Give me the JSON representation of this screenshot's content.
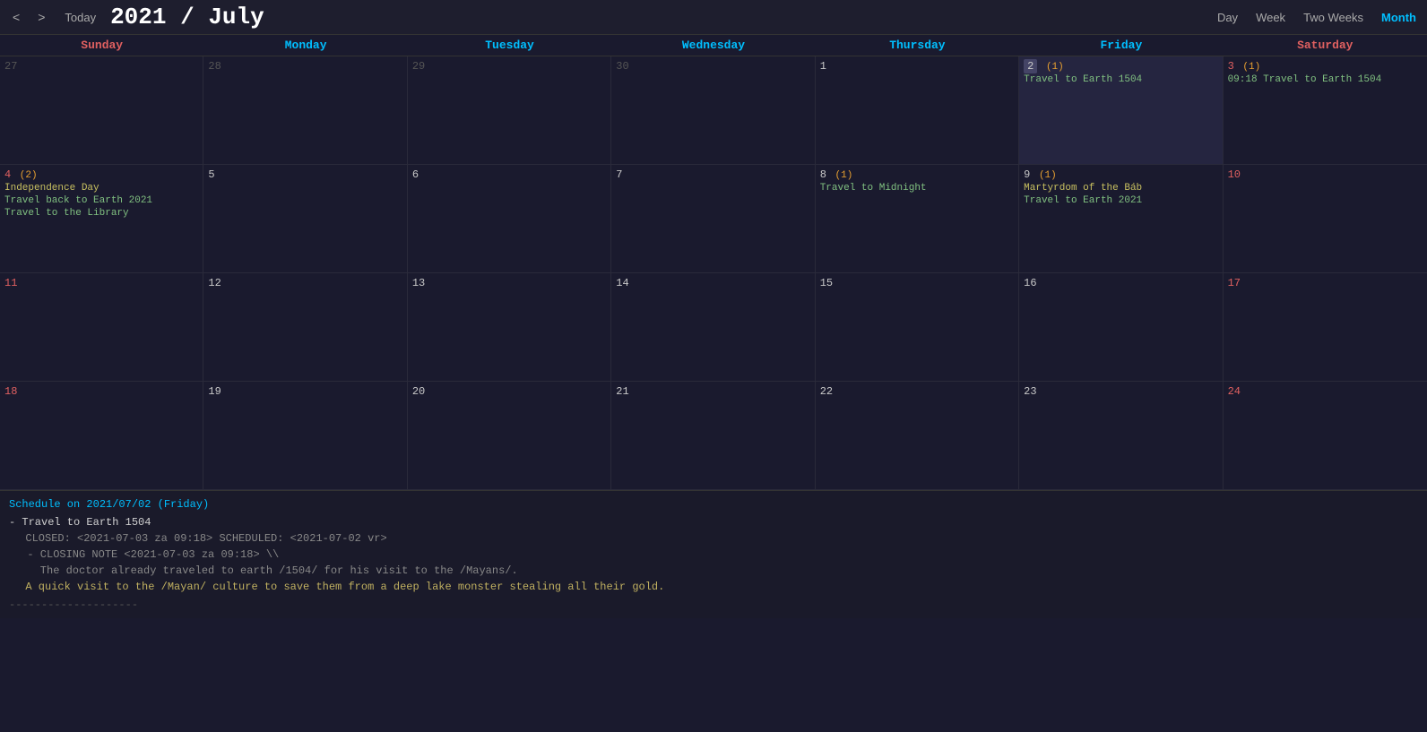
{
  "header": {
    "title_year": "2021",
    "title_separator": " / ",
    "title_month": "July",
    "nav_prev": "<",
    "nav_next": ">",
    "today_label": "Today",
    "views": [
      "Day",
      "Week",
      "Two Weeks",
      "Month"
    ],
    "active_view": "Month"
  },
  "day_headers": [
    {
      "label": "Sunday",
      "type": "sun"
    },
    {
      "label": "Monday",
      "type": "weekday"
    },
    {
      "label": "Tuesday",
      "type": "weekday"
    },
    {
      "label": "Wednesday",
      "type": "weekday"
    },
    {
      "label": "Thursday",
      "type": "weekday"
    },
    {
      "label": "Friday",
      "type": "weekday"
    },
    {
      "label": "Saturday",
      "type": "sat"
    }
  ],
  "weeks": [
    {
      "days": [
        {
          "num": "27",
          "badi": "",
          "other": true,
          "type": "sun",
          "events": []
        },
        {
          "num": "28",
          "badi": "",
          "other": true,
          "type": "weekday",
          "events": []
        },
        {
          "num": "29",
          "badi": "",
          "other": true,
          "type": "weekday",
          "events": []
        },
        {
          "num": "30",
          "badi": "",
          "other": true,
          "type": "weekday",
          "events": []
        },
        {
          "num": "1",
          "badi": "",
          "other": false,
          "type": "weekday",
          "events": []
        },
        {
          "num": "2",
          "badi": "(1)",
          "other": false,
          "type": "weekday",
          "today": true,
          "events": [
            {
              "label": "Travel to Earth 1504",
              "cls": "event"
            }
          ]
        },
        {
          "num": "3",
          "badi": "(1)",
          "other": false,
          "type": "sat",
          "events": [
            {
              "label": "09:18 Travel to Earth 1504",
              "cls": "event"
            }
          ]
        }
      ]
    },
    {
      "days": [
        {
          "num": "4",
          "badi": "(2)",
          "other": false,
          "type": "sun",
          "events": [
            {
              "label": "Independence Day",
              "cls": "event holiday"
            },
            {
              "label": "Travel back to Earth 2021",
              "cls": "event"
            },
            {
              "label": "Travel to the Library",
              "cls": "event"
            }
          ]
        },
        {
          "num": "5",
          "badi": "",
          "other": false,
          "type": "weekday",
          "events": []
        },
        {
          "num": "6",
          "badi": "",
          "other": false,
          "type": "weekday",
          "events": []
        },
        {
          "num": "7",
          "badi": "",
          "other": false,
          "type": "weekday",
          "events": []
        },
        {
          "num": "8",
          "badi": "(1)",
          "other": false,
          "type": "weekday",
          "events": [
            {
              "label": "Travel to Midnight",
              "cls": "event"
            }
          ]
        },
        {
          "num": "9",
          "badi": "(1)",
          "other": false,
          "type": "weekday",
          "events": [
            {
              "label": "Martyrdom of the Báb",
              "cls": "event holiday"
            },
            {
              "label": "Travel to Earth 2021",
              "cls": "event"
            }
          ]
        },
        {
          "num": "10",
          "badi": "",
          "other": false,
          "type": "sat",
          "events": []
        }
      ]
    },
    {
      "days": [
        {
          "num": "11",
          "badi": "",
          "other": false,
          "type": "sun",
          "events": []
        },
        {
          "num": "12",
          "badi": "",
          "other": false,
          "type": "weekday",
          "events": []
        },
        {
          "num": "13",
          "badi": "",
          "other": false,
          "type": "weekday",
          "events": []
        },
        {
          "num": "14",
          "badi": "",
          "other": false,
          "type": "weekday",
          "events": []
        },
        {
          "num": "15",
          "badi": "",
          "other": false,
          "type": "weekday",
          "events": []
        },
        {
          "num": "16",
          "badi": "",
          "other": false,
          "type": "weekday",
          "events": []
        },
        {
          "num": "17",
          "badi": "",
          "other": false,
          "type": "sat",
          "events": []
        }
      ]
    },
    {
      "days": [
        {
          "num": "18",
          "badi": "",
          "other": false,
          "type": "sun",
          "events": []
        },
        {
          "num": "19",
          "badi": "",
          "other": false,
          "type": "weekday",
          "events": []
        },
        {
          "num": "20",
          "badi": "",
          "other": false,
          "type": "weekday",
          "events": []
        },
        {
          "num": "21",
          "badi": "",
          "other": false,
          "type": "weekday",
          "events": []
        },
        {
          "num": "22",
          "badi": "",
          "other": false,
          "type": "weekday",
          "events": []
        },
        {
          "num": "23",
          "badi": "",
          "other": false,
          "type": "weekday",
          "events": []
        },
        {
          "num": "24",
          "badi": "",
          "other": false,
          "type": "sat",
          "events": []
        }
      ]
    }
  ],
  "schedule": {
    "date_line": "Schedule on 2021/07/02 (Friday)",
    "items": [
      {
        "title": "- Travel to Earth 1504",
        "meta": "CLOSED: <2021-07-03 za 09:18> SCHEDULED: <2021-07-02 vr>",
        "note": "- CLOSING NOTE <2021-07-03 za 09:18> \\",
        "note2": "  The doctor already traveled to earth /1504/ for his visit to the /Mayans/.",
        "desc": "A quick visit to the /Mayan/ culture to save them from a deep lake monster stealing all their gold."
      }
    ],
    "divider": "--------------------"
  }
}
